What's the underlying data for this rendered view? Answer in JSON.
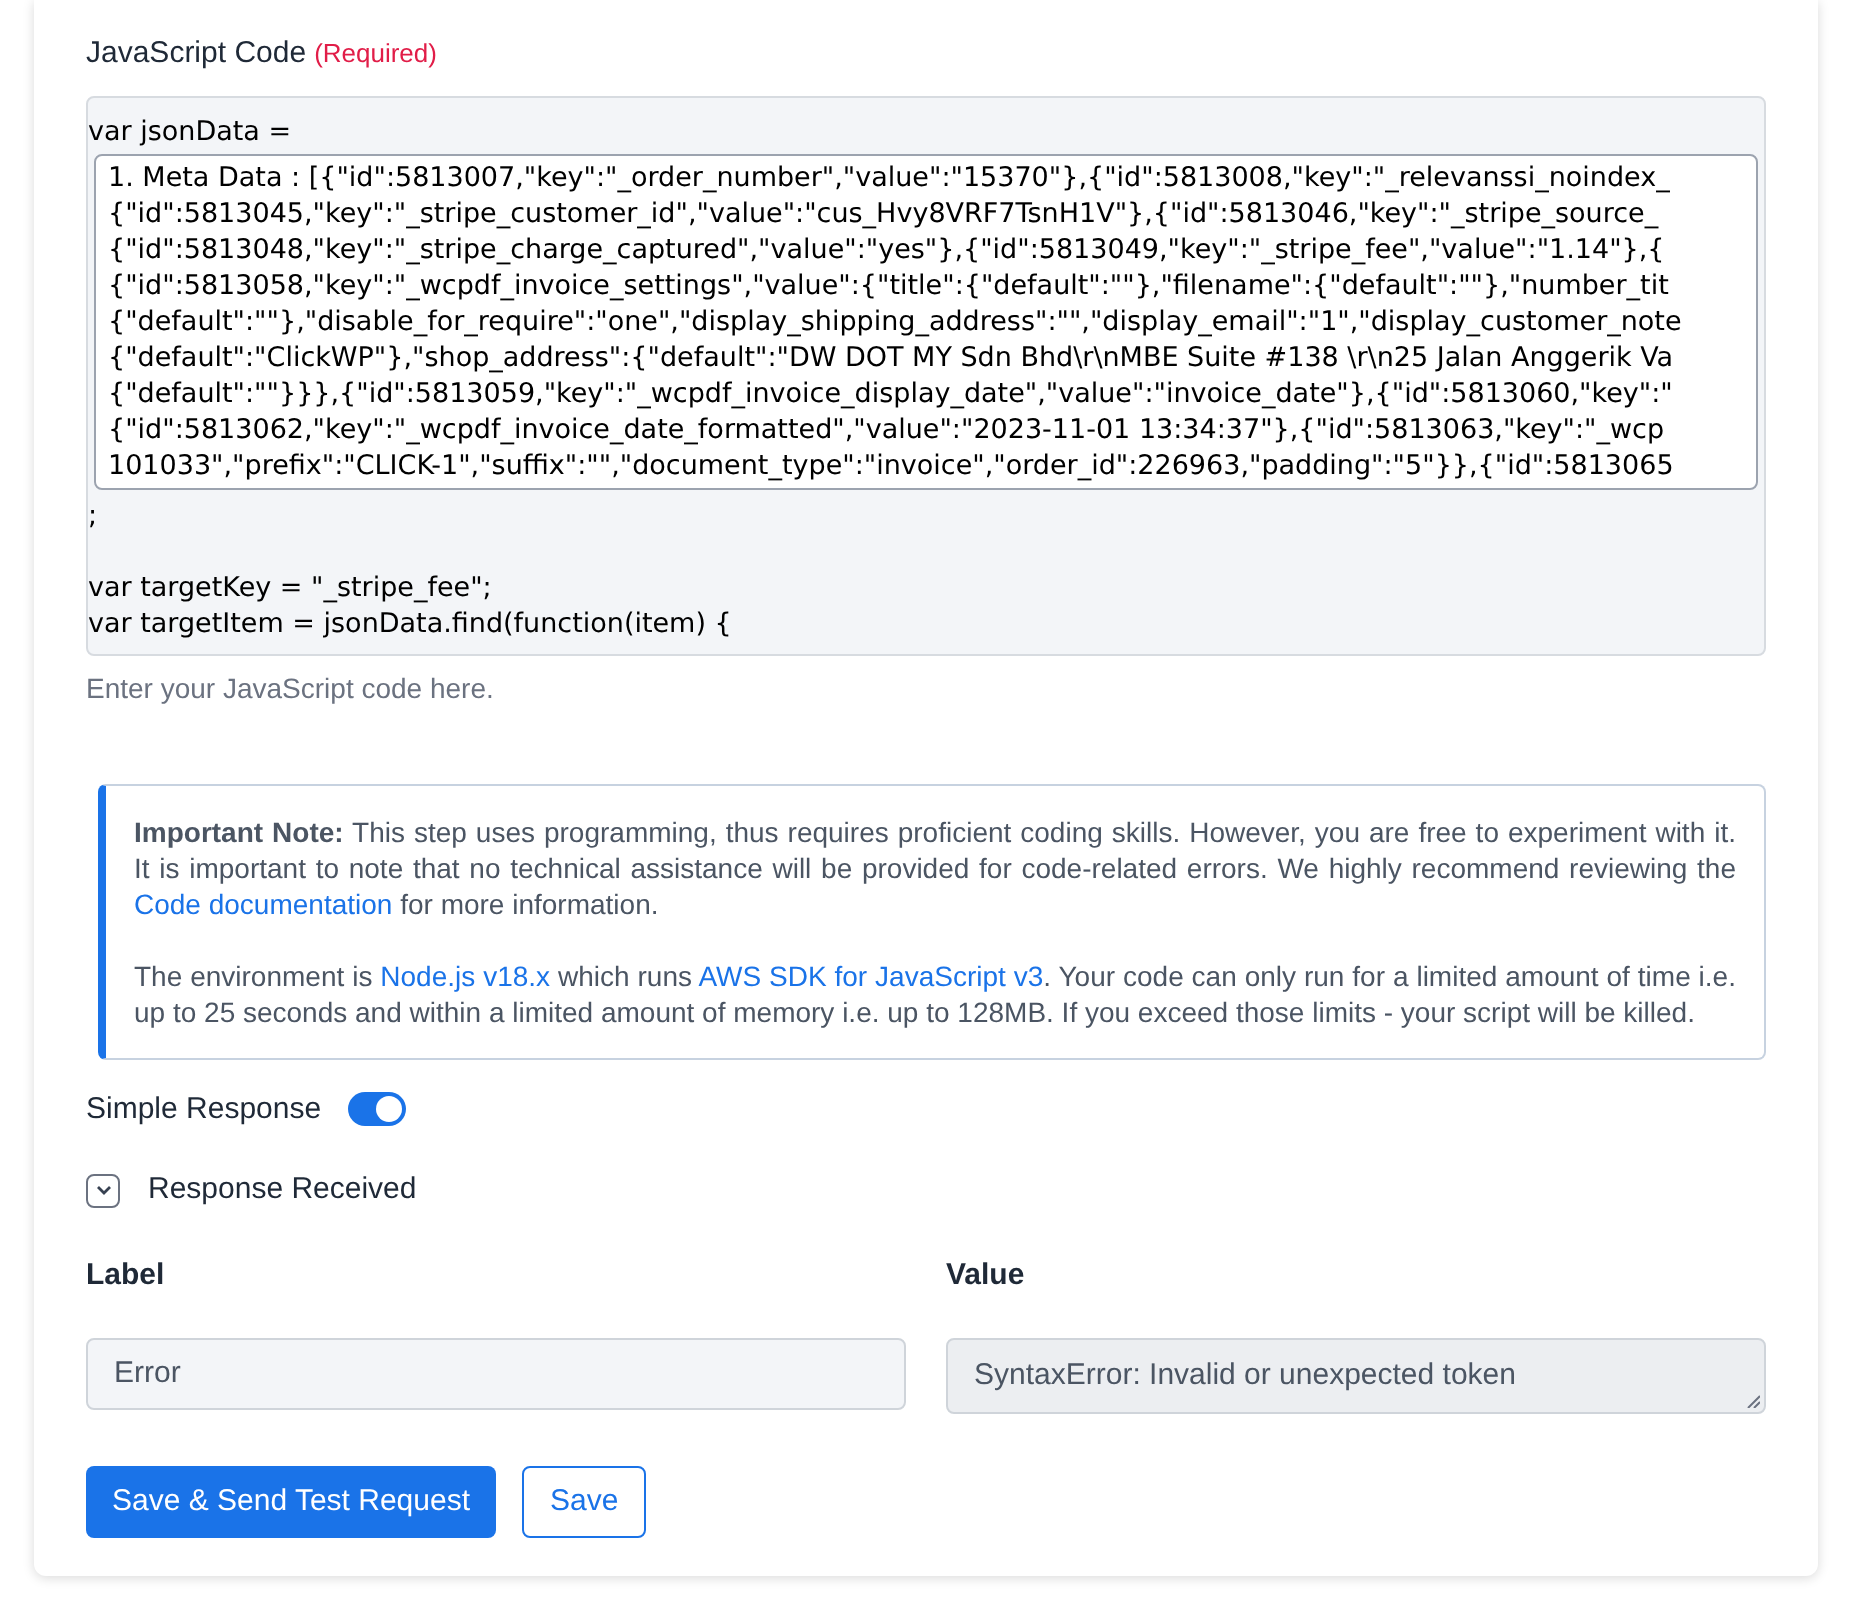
{
  "code_field": {
    "label": "JavaScript Code",
    "required_tag": "(Required)",
    "lines_before": [
      "var jsonData ="
    ],
    "data_lines": [
      "1. Meta Data : [{\"id\":5813007,\"key\":\"_order_number\",\"value\":\"15370\"},{\"id\":5813008,\"key\":\"_relevanssi_noindex_",
      "{\"id\":5813045,\"key\":\"_stripe_customer_id\",\"value\":\"cus_Hvy8VRF7TsnH1V\"},{\"id\":5813046,\"key\":\"_stripe_source_",
      "{\"id\":5813048,\"key\":\"_stripe_charge_captured\",\"value\":\"yes\"},{\"id\":5813049,\"key\":\"_stripe_fee\",\"value\":\"1.14\"},{",
      "{\"id\":5813058,\"key\":\"_wcpdf_invoice_settings\",\"value\":{\"title\":{\"default\":\"\"},\"filename\":{\"default\":\"\"},\"number_tit",
      "{\"default\":\"\"},\"disable_for_require\":\"one\",\"display_shipping_address\":\"\",\"display_email\":\"1\",\"display_customer_note",
      "{\"default\":\"ClickWP\"},\"shop_address\":{\"default\":\"DW DOT MY Sdn Bhd\\r\\nMBE Suite #138 \\r\\n25 Jalan Anggerik Va",
      "{\"default\":\"\"}}},{\"id\":5813059,\"key\":\"_wcpdf_invoice_display_date\",\"value\":\"invoice_date\"},{\"id\":5813060,\"key\":\"",
      "{\"id\":5813062,\"key\":\"_wcpdf_invoice_date_formatted\",\"value\":\"2023-11-01 13:34:37\"},{\"id\":5813063,\"key\":\"_wcp",
      "101033\",\"prefix\":\"CLICK-1\",\"suffix\":\"\",\"document_type\":\"invoice\",\"order_id\":226963,\"padding\":\"5\"}},{\"id\":5813065"
    ],
    "lines_after": [
      ";",
      "var targetKey = \"_stripe_fee\";",
      "var targetItem = jsonData.find(function(item) {"
    ],
    "help": "Enter your JavaScript code here."
  },
  "note": {
    "paragraphs": [
      [
        {
          "kind": "bold",
          "text": "Important Note:"
        },
        {
          "kind": "text",
          "text": " This step uses programming, thus requires proficient coding skills. However, you are free to experiment with it. It is important to note that no technical assistance will be provided for code-related errors. We highly recommend reviewing the "
        },
        {
          "kind": "link",
          "text": "Code documentation"
        },
        {
          "kind": "text",
          "text": " for more information."
        }
      ],
      [
        {
          "kind": "text",
          "text": "The environment is "
        },
        {
          "kind": "link",
          "text": "Node.js v18.x"
        },
        {
          "kind": "text",
          "text": " which runs "
        },
        {
          "kind": "link",
          "text": "AWS SDK for JavaScript v3"
        },
        {
          "kind": "text",
          "text": ". Your code can only run for a limited amount of time i.e. up to 25 seconds and within a limited amount of memory i.e. up to 128MB. If you exceed those limits - your script will be killed."
        }
      ]
    ]
  },
  "simple_response": {
    "label": "Simple Response",
    "on": true
  },
  "response_received": {
    "label": "Response Received",
    "expanded": true,
    "columns": [
      "Label",
      "Value"
    ],
    "label_value": "Error",
    "value_value": "SyntaxError: Invalid or unexpected token"
  },
  "buttons": [
    {
      "label": "Save & Send Test Request",
      "kind": "primary"
    },
    {
      "label": "Save",
      "kind": "outline"
    }
  ]
}
